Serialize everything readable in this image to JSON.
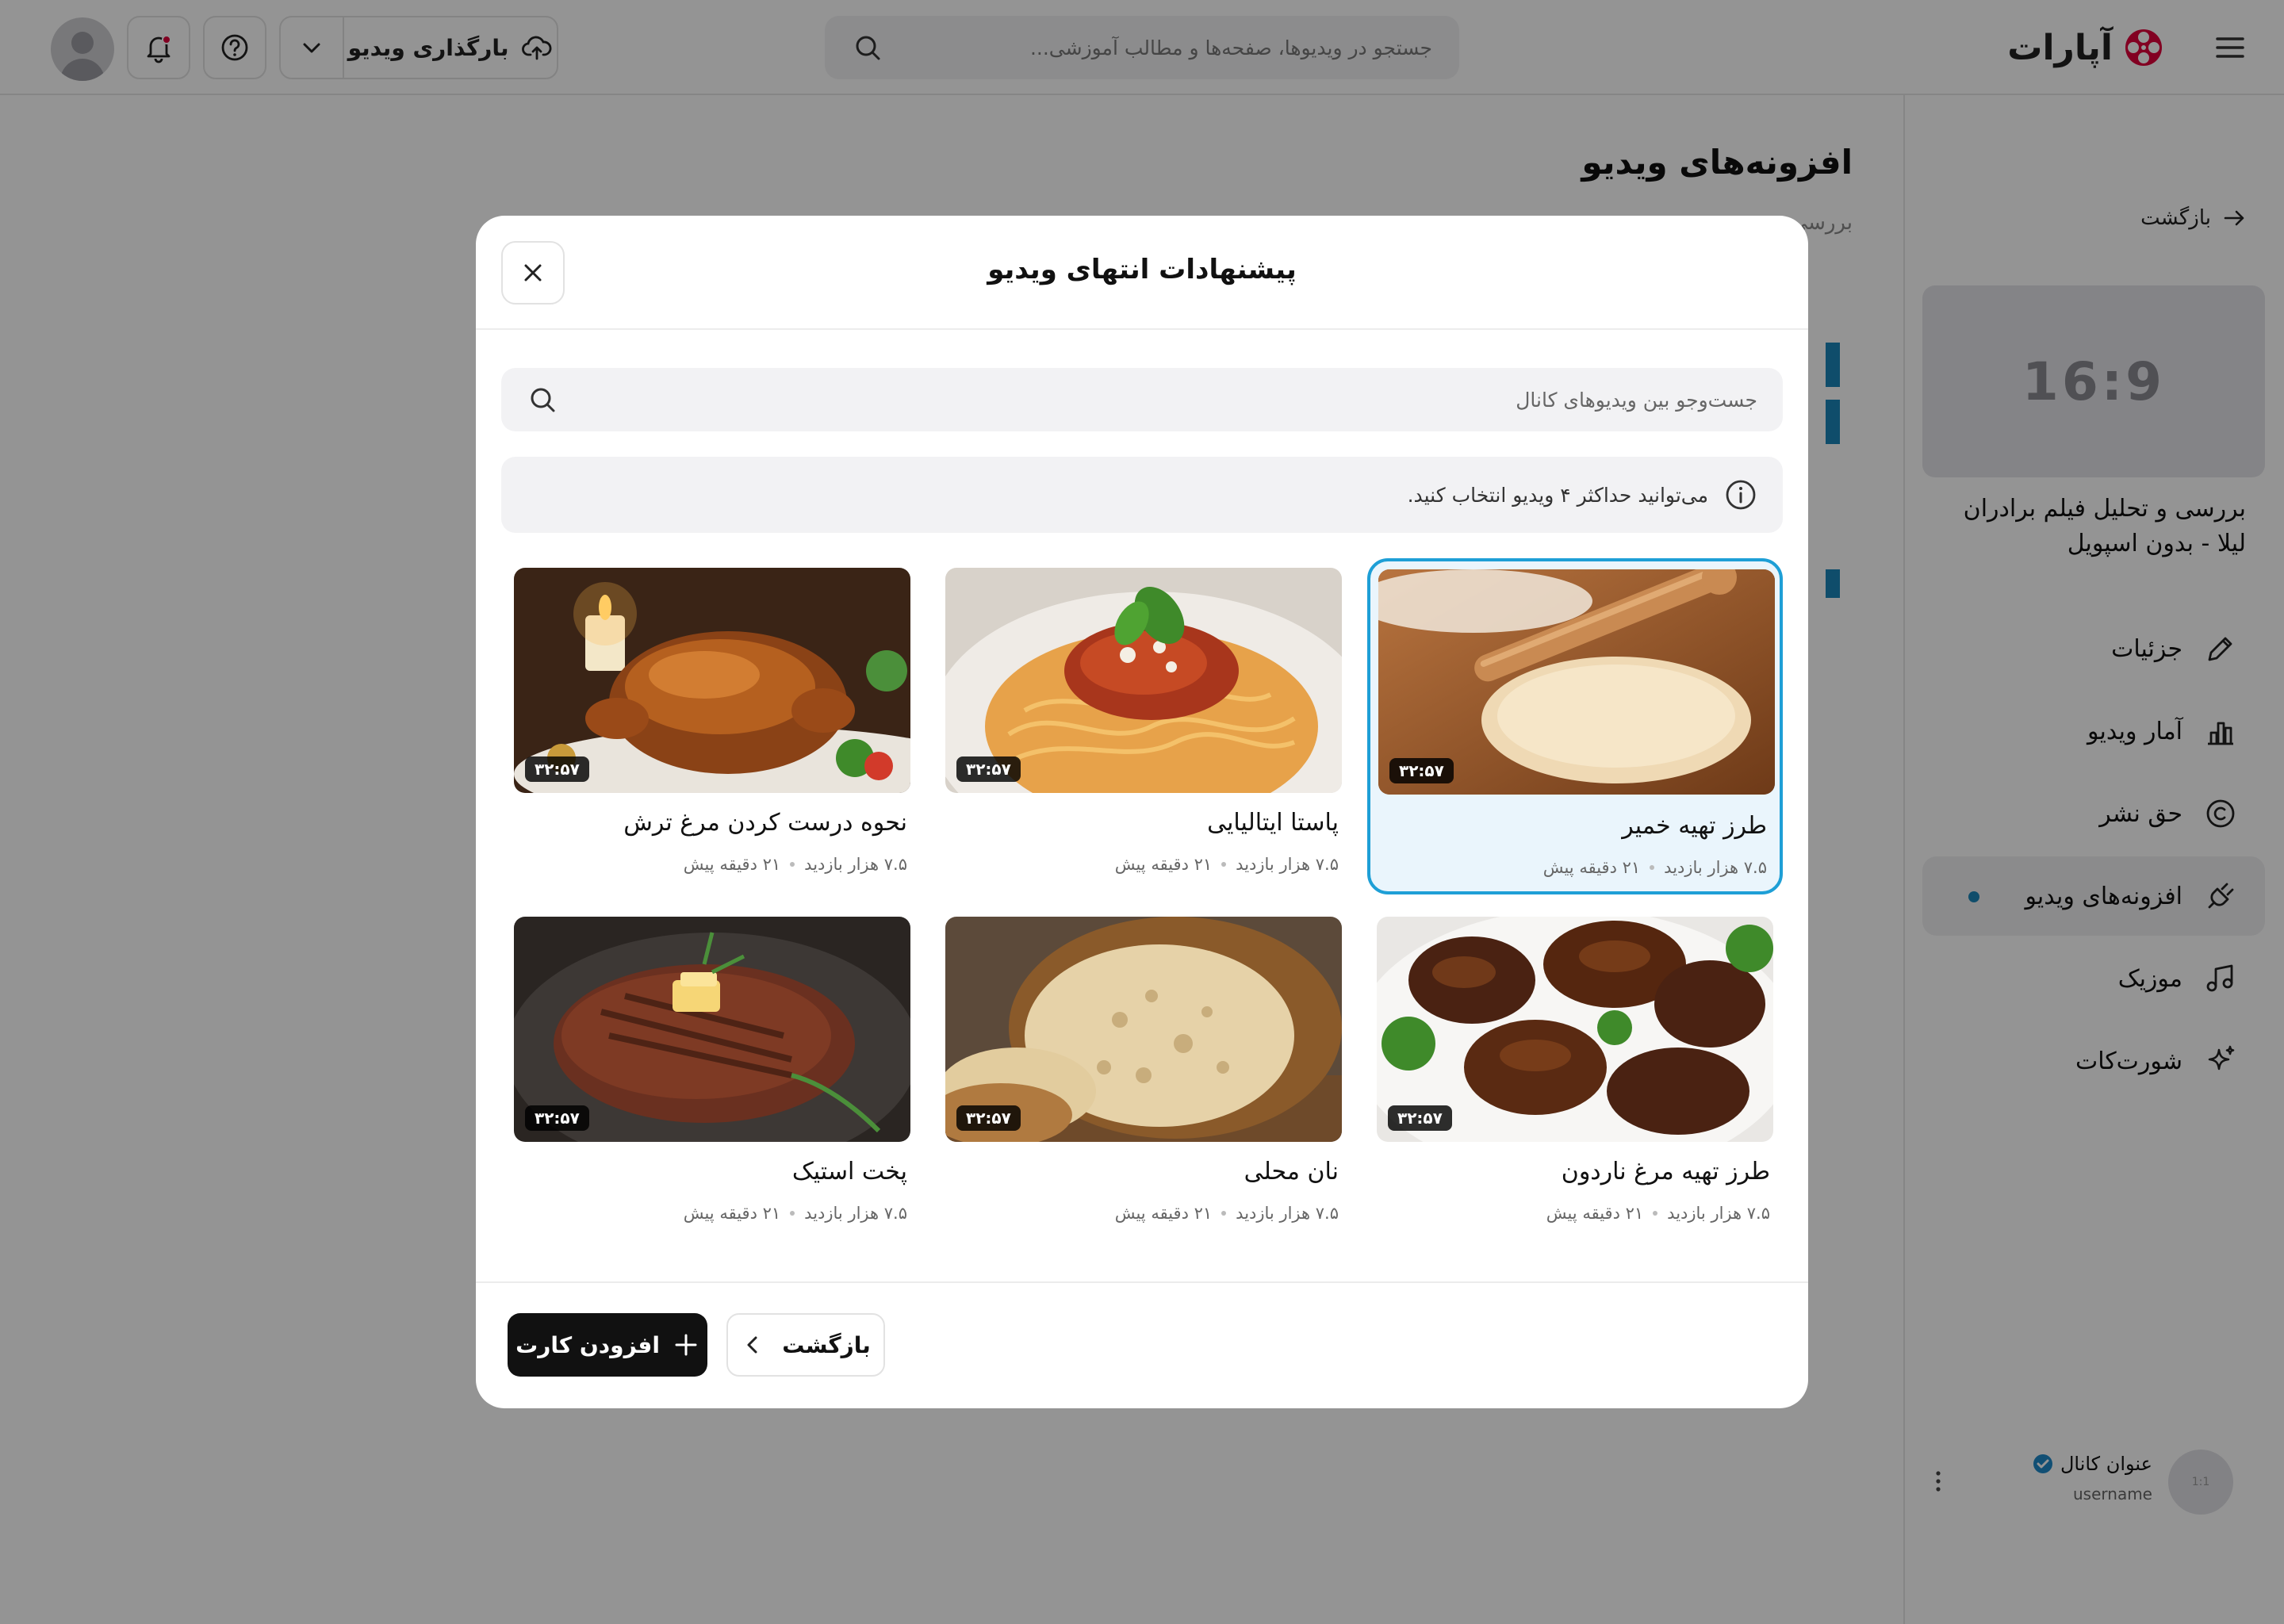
{
  "header": {
    "logo_text": "آپارات",
    "search_placeholder": "جستجو در ویدیوها، صفحه‌ها و مطالب آموزشی...",
    "upload_label": "بارگذاری ویدیو"
  },
  "sidebar": {
    "back_label": "بازگشت",
    "thumb_ratio": "16:9",
    "video_title": "بررسی و تحلیل فیلم برادران لیلا - بدون اسپویل",
    "items": [
      {
        "label": "جزئیات",
        "icon": "pencil-icon"
      },
      {
        "label": "آمار ویدیو",
        "icon": "bar-chart-icon"
      },
      {
        "label": "حق نشر",
        "icon": "copyright-icon"
      },
      {
        "label": "افزونه‌های ویدیو",
        "icon": "plug-icon",
        "active": true
      },
      {
        "label": "موزیک",
        "icon": "music-icon"
      },
      {
        "label": "شورت‌کات",
        "icon": "sparkle-icon"
      }
    ],
    "channel": {
      "name": "عنوان کانال",
      "username": "username",
      "avatar_ratio": "1:1"
    }
  },
  "page": {
    "title": "افزونه‌های ویدیو",
    "subtitle_fragment": "بررسی"
  },
  "modal": {
    "title": "پیشنهادات انتهای ویدیو",
    "search_placeholder": "جست‌وجو بین ویدیوهای کانال",
    "info_text": "می‌توانید حداکثر ۴ ویدیو انتخاب کنید.",
    "videos": [
      {
        "title": "طرز تهیه خمیر",
        "duration": "۳۲:۵۷",
        "views": "۷.۵ هزار بازدید",
        "time": "۲۱ دقیقه پیش",
        "selected": true,
        "thumb": "dough"
      },
      {
        "title": "پاستا ایتالیایی",
        "duration": "۳۲:۵۷",
        "views": "۷.۵ هزار بازدید",
        "time": "۲۱ دقیقه پیش",
        "selected": false,
        "thumb": "pasta"
      },
      {
        "title": "نحوه درست کردن مرغ ترش",
        "duration": "۳۲:۵۷",
        "views": "۷.۵ هزار بازدید",
        "time": "۲۱ دقیقه پیش",
        "selected": false,
        "thumb": "roast-chicken"
      },
      {
        "title": "طرز تهیه مرغ ناردون",
        "duration": "۳۲:۵۷",
        "views": "۷.۵ هزار بازدید",
        "time": "۲۱ دقیقه پیش",
        "selected": false,
        "thumb": "glazed-chicken"
      },
      {
        "title": "نان محلی",
        "duration": "۳۲:۵۷",
        "views": "۷.۵ هزار بازدید",
        "time": "۲۱ دقیقه پیش",
        "selected": false,
        "thumb": "bread"
      },
      {
        "title": "پخت استیک",
        "duration": "۳۲:۵۷",
        "views": "۷.۵ هزار بازدید",
        "time": "۲۱ دقیقه پیش",
        "selected": false,
        "thumb": "steak"
      }
    ],
    "back_button": "بازگشت",
    "add_button": "افزودن کارت"
  },
  "colors": {
    "accent": "#1e9fd6",
    "selected_bg": "#eaf5fc",
    "primary_button": "#111111",
    "logo_red": "#e0003b",
    "overlay": "rgba(0,0,0,0.42)"
  }
}
